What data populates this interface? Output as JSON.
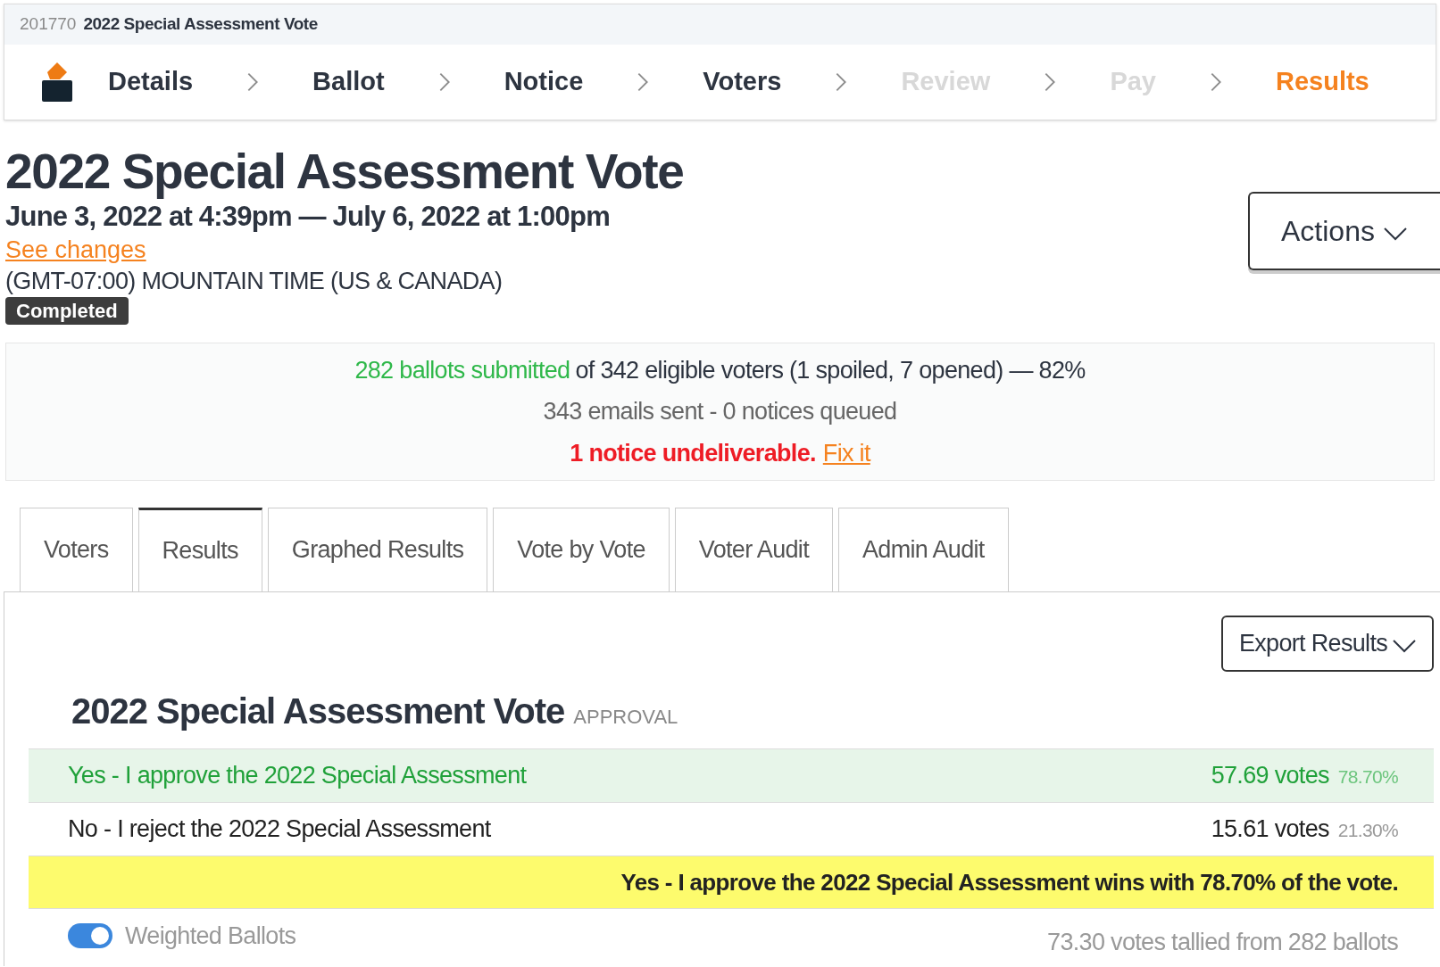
{
  "header": {
    "id": "201770",
    "title": "2022 Special Assessment Vote"
  },
  "steps": [
    {
      "label": "Details",
      "disabled": false,
      "selected": false
    },
    {
      "label": "Ballot",
      "disabled": false,
      "selected": false
    },
    {
      "label": "Notice",
      "disabled": false,
      "selected": false
    },
    {
      "label": "Voters",
      "disabled": false,
      "selected": false
    },
    {
      "label": "Review",
      "disabled": true,
      "selected": false
    },
    {
      "label": "Pay",
      "disabled": true,
      "selected": false
    },
    {
      "label": "Results",
      "disabled": false,
      "selected": true
    }
  ],
  "election": {
    "title": "2022 Special Assessment Vote",
    "dates": "June 3, 2022 at 4:39pm — July 6, 2022 at 1:00pm",
    "changes_link": "See changes",
    "timezone": "(GMT-07:00) MOUNTAIN TIME (US & CANADA)",
    "status": "Completed"
  },
  "actions_button": "Actions",
  "summary": {
    "submitted": "282 ballots submitted",
    "eligible": "of 342 eligible voters (1 spoiled, 7 opened) — 82%",
    "emails": "343 emails sent - 0 notices queued",
    "warning": "1 notice undeliverable.",
    "fix_link": "Fix it"
  },
  "tabs": [
    {
      "label": "Voters",
      "selected": false
    },
    {
      "label": "Results",
      "selected": true
    },
    {
      "label": "Graphed Results",
      "selected": false
    },
    {
      "label": "Vote by Vote",
      "selected": false
    },
    {
      "label": "Voter Audit",
      "selected": false
    },
    {
      "label": "Admin Audit",
      "selected": false
    }
  ],
  "export_button": "Export Results",
  "question": {
    "title": "2022 Special Assessment Vote",
    "type": "APPROVAL"
  },
  "options": [
    {
      "label": "Yes - I approve the 2022 Special Assessment",
      "votes": "57.69 votes",
      "percent": "78.70%",
      "winner": true
    },
    {
      "label": "No - I reject the 2022 Special Assessment",
      "votes": "15.61 votes",
      "percent": "21.30%",
      "winner": false
    }
  ],
  "outcome": "Yes - I approve the 2022 Special Assessment wins with 78.70% of the vote.",
  "weighted": {
    "label": "Weighted Ballots",
    "on": true
  },
  "tally": "73.30 votes tallied from 282 ballots"
}
